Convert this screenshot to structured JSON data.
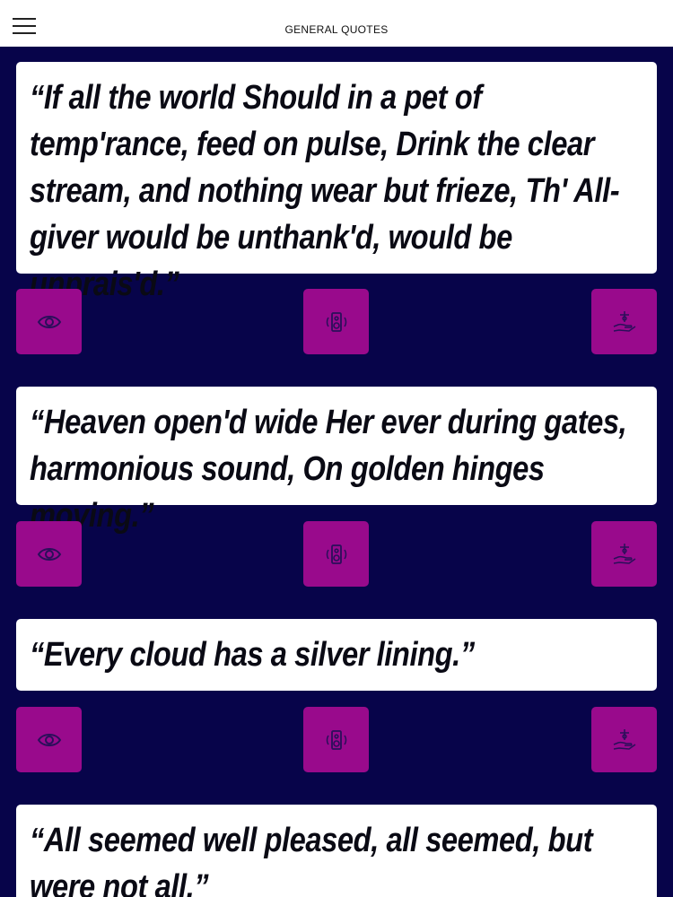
{
  "header": {
    "title": "GENERAL QUOTES",
    "menu_icon": "hamburger-icon"
  },
  "colors": {
    "background": "#07044a",
    "card": "#ffffff",
    "button": "#990a8c",
    "icon": "#2a0f5a"
  },
  "quotes": [
    {
      "text": "“If all the world Should in a pet of temp'rance, feed on pulse, Drink the clear stream, and nothing wear but frieze, Th' All-giver would be unthank'd, would be unprais'd.”"
    },
    {
      "text": "“Heaven open'd wide Her ever during gates, harmonious sound, On golden hinges moving.”"
    },
    {
      "text": "“Every cloud has a silver lining.”"
    },
    {
      "text": "“All seemed well pleased, all seemed, but were not all.”"
    }
  ],
  "action_icons": [
    "eye-icon",
    "speaker-icon",
    "donate-icon"
  ]
}
